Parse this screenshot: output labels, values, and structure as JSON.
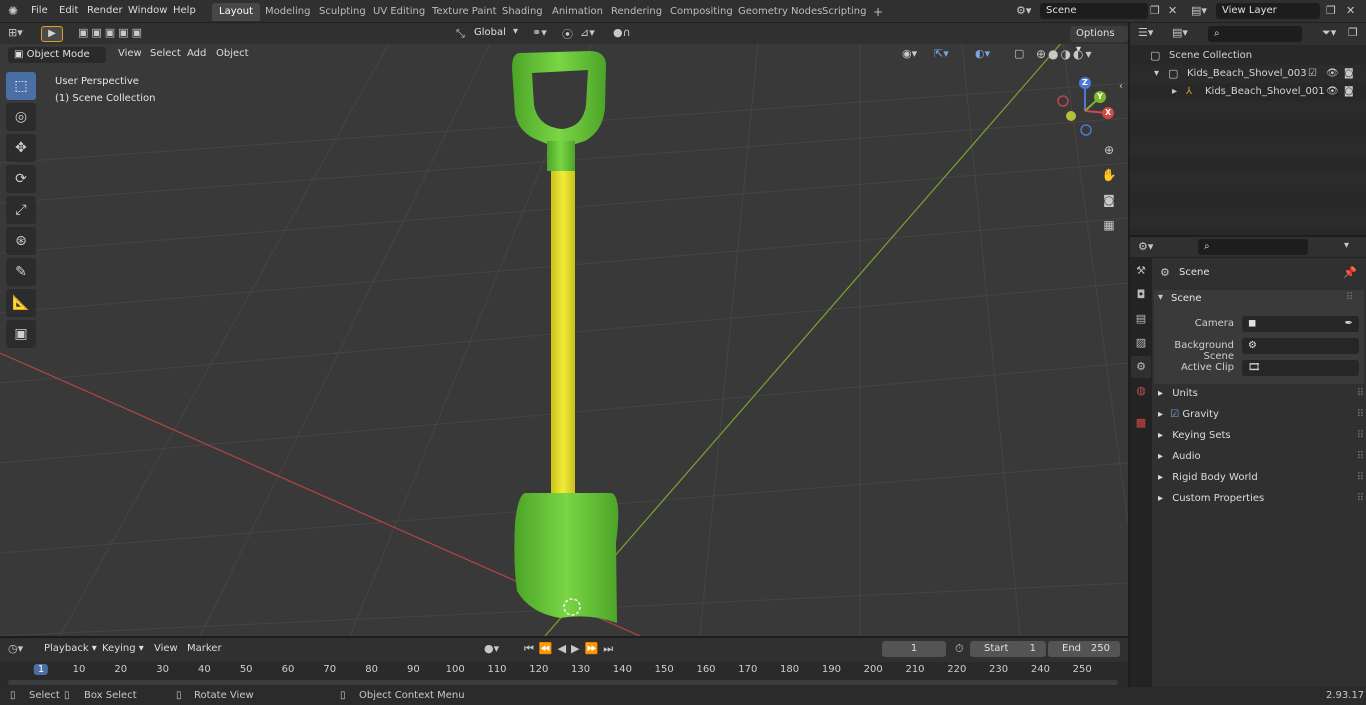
{
  "menus": [
    "File",
    "Edit",
    "Render",
    "Window",
    "Help"
  ],
  "workspaces": [
    "Layout",
    "Modeling",
    "Sculpting",
    "UV Editing",
    "Texture Paint",
    "Shading",
    "Animation",
    "Rendering",
    "Compositing",
    "Geometry Nodes",
    "Scripting",
    "+"
  ],
  "scene_field": "Scene",
  "view_layer_field": "View Layer",
  "viewport": {
    "mode": "Object Mode",
    "menu": [
      "View",
      "Select",
      "Add",
      "Object"
    ],
    "transform_orientation": "Global",
    "options": "Options",
    "overlay_title": "User Perspective",
    "overlay_sub": "(1) Scene Collection"
  },
  "gizmo": {
    "x": "X",
    "y": "Y",
    "z": "Z"
  },
  "outliner": {
    "root": "Scene Collection",
    "items": [
      "Kids_Beach_Shovel_003",
      "Kids_Beach_Shovel_001"
    ]
  },
  "properties": {
    "context": "Scene",
    "section": "Scene",
    "fields": [
      {
        "label": "Camera"
      },
      {
        "label": "Background Scene"
      },
      {
        "label": "Active Clip"
      }
    ],
    "panels": [
      "Units",
      "Gravity",
      "Keying Sets",
      "Audio",
      "Rigid Body World",
      "Custom Properties"
    ]
  },
  "timeline": {
    "menus": [
      "Playback",
      "Keying",
      "View",
      "Marker"
    ],
    "current_frame": "1",
    "start_label": "Start",
    "start": "1",
    "end_label": "End",
    "end": "250",
    "ruler": [
      "1",
      "10",
      "20",
      "30",
      "40",
      "50",
      "60",
      "70",
      "80",
      "90",
      "100",
      "110",
      "120",
      "130",
      "140",
      "150",
      "160",
      "170",
      "180",
      "190",
      "200",
      "210",
      "220",
      "230",
      "240",
      "250"
    ]
  },
  "status": {
    "items": [
      "Select",
      "Box Select",
      "Rotate View",
      "Object Context Menu"
    ],
    "version": "2.93.17"
  },
  "colors": {
    "accent": "#4a6fa5",
    "shovel_green": "#6cc93a",
    "handle_yellow": "#e3e01f",
    "x_axis": "#c44a4a",
    "y_axis": "#7bb82c"
  }
}
